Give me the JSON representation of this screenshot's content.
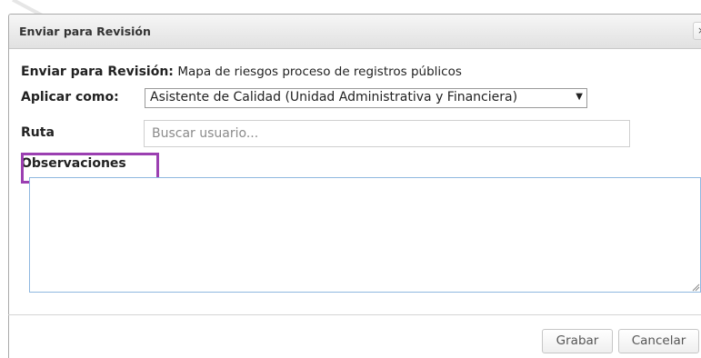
{
  "dialog": {
    "title": "Enviar para Revisión",
    "close_glyph": "×"
  },
  "form": {
    "enviar_label": "Enviar para Revisión:",
    "enviar_value": "Mapa de riesgos proceso de registros públicos",
    "aplicar_label": "Aplicar como:",
    "aplicar_selected": "Asistente de Calidad (Unidad Administrativa y Financiera)",
    "ruta_label": "Ruta",
    "ruta_placeholder": "Buscar usuario...",
    "observaciones_label": "Observaciones",
    "observaciones_value": ""
  },
  "footer": {
    "save_label": "Grabar",
    "cancel_label": "Cancelar"
  },
  "colors": {
    "highlight": "#9b3fb1",
    "textarea_border": "#8fb8e0"
  },
  "icons": {
    "select_arrow": "chevron-down-icon",
    "close": "close-icon",
    "resize": "resize-handle-icon"
  }
}
